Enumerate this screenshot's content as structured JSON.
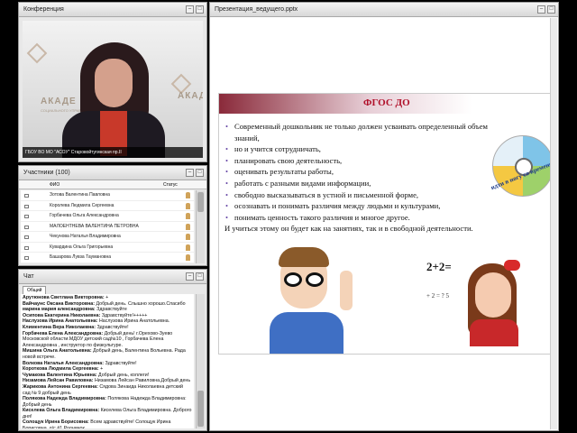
{
  "conference": {
    "title": "Конференция",
    "video_caption": "ГБОУ ВО МО \"АСОУ\" Старовойтугинская пр.II",
    "wall_logo": "АКАДЕ",
    "wall_logo_sub": "СОЦИАЛЬНОГО УПРАВЛЕНИЯ"
  },
  "participants": {
    "title": "Участники (100)",
    "col_name": "ФИО",
    "col_status": "Статус",
    "list": [
      "Зотова Валентина Павловна",
      "Королева Людмила Сергеевна",
      "Горбачева Ольга Александровна",
      "МАЛОЕНТНЕВА ВАЛЕНТИНА ПЕТРОВНА",
      "Чекунова Наталья Владимировна",
      "Кувардина Ольга Григорьевна",
      "Башарова Лувза Таумановна"
    ]
  },
  "chat": {
    "title": "Чат",
    "tab": "Общий",
    "messages": [
      {
        "name": "Арутюнова Светлана Викторовна:",
        "text": "+"
      },
      {
        "name": "Вайчаунс Оксана Викторовна:",
        "text": "Добрый день. Слышно хорошо.Спасибо"
      },
      {
        "name": "марина мария александровна:",
        "text": "Здравствуйте"
      },
      {
        "name": "Осипова Екатерина Николаевна:",
        "text": "Здравствуйте!+++++"
      },
      {
        "name": "Наслузова Ирина Анатольевна:",
        "text": "Наслузова Ирина Анатольевна."
      },
      {
        "name": "Климентина Вера Николаевна:",
        "text": "Здравствуйте!"
      },
      {
        "name": "Горбачева Елена Александровна:",
        "text": "Добрый день! г.Орехово-Зуево Московской области.МДОУ детский сад№10 , Горбачева Елена Александровна , инструктор по физкультуре."
      },
      {
        "name": "Мишина Ольга Анатольевна:",
        "text": "Добрый день, Валентина Вольевна. Рада новой встрече."
      },
      {
        "name": "Волкова Наталья Александровна:",
        "text": "Здравствуйте!"
      },
      {
        "name": "Короткова Людмила Сергеевна:",
        "text": "+"
      },
      {
        "name": "Чумакова Валентина Юрьевна:",
        "text": "Добрый день, коллеги!"
      },
      {
        "name": "Низамова Лейсан Равиловна:",
        "text": "Низамова Лейсан Равиловна.Добрый день"
      },
      {
        "name": "Жарикова Антонина Сергеевна:",
        "text": "Сядова Зинаида Николаевна детский сад № 9 добрый день"
      },
      {
        "name": "Полякова Надежда Владимировна:",
        "text": "Полякова Надежда Владимировна: Добрый день"
      },
      {
        "name": "Киселева Ольга Владимировна:",
        "text": "Киселева Ольга Владимировна. Доброго дня!"
      },
      {
        "name": "Солощук Ирина Борисовна:",
        "text": "Всем здравствуйте! Солощук Ирина Борисовна, д/с #1 Родничок"
      }
    ]
  },
  "presentation": {
    "title": "Презентация_ведущего.pptx",
    "slide_title": "ФГОС ДО",
    "bullets": [
      "Современный дошкольник не только должен усваивать определенный объем знаний,",
      "но и учится сотрудничать,",
      "планировать свою деятельность,",
      " оценивать результаты работы,",
      "работать с разными видами информации,",
      "свободно высказываться в устной и письменной форме,",
      " осознавать и понимать различия между людьми и культурами,",
      "понимать ценность такого различия и многое другое."
    ],
    "closing": "И учиться этому он будет как на занятиях, так и в свободной  деятельности.",
    "wheel_caption": "идти в ногу со временем",
    "math_text": "2+2=",
    "math_text_2": "+ 2 = ? 5"
  }
}
